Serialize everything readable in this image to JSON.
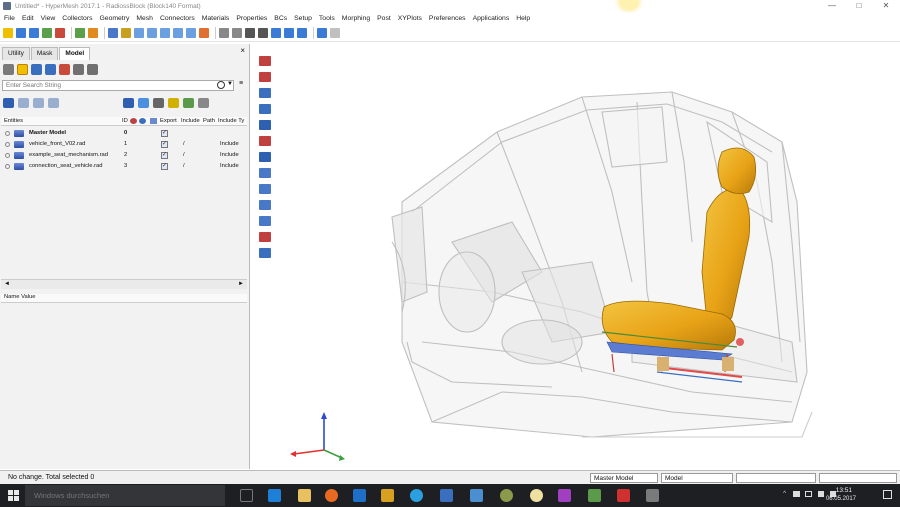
{
  "window": {
    "title": "Untitled* - HyperMesh 2017.1 - RadiossBlock (Block140 Format)",
    "minimize": "—",
    "maximize": "□",
    "close": "✕"
  },
  "menu": [
    "File",
    "Edit",
    "View",
    "Collectors",
    "Geometry",
    "Mesh",
    "Connectors",
    "Materials",
    "Properties",
    "BCs",
    "Setup",
    "Tools",
    "Morphing",
    "Post",
    "XYPlots",
    "Preferences",
    "Applications",
    "Help"
  ],
  "panel": {
    "tabs": [
      "Utility",
      "Mask",
      "Model"
    ],
    "active_tab": "Model",
    "close_label": "×",
    "search_placeholder": "Enter Search String",
    "search_dropdown": "▼",
    "search_menu": "≡",
    "tree_columns": {
      "entities": "Entities",
      "id": "ID",
      "export": "Export",
      "include": "Include",
      "path": "Path",
      "include_type": "Include Ty"
    },
    "tree_rows": [
      {
        "name": "Master Model",
        "id": "0",
        "path": "",
        "include_type": "",
        "bold": true
      },
      {
        "name": "vehicle_front_V02.rad",
        "id": "1",
        "path": "/",
        "include_type": "Include"
      },
      {
        "name": "example_seat_mechanism.rad",
        "id": "2",
        "path": "/",
        "include_type": "Include"
      },
      {
        "name": "connection_seat_vehicle.rad",
        "id": "3",
        "path": "/",
        "include_type": "Include"
      }
    ],
    "checkmark": "✓",
    "scroll_left": "◄",
    "scroll_right": "►",
    "props_columns": "Name Value"
  },
  "status": {
    "message": "No change. Total selected 0",
    "field1": "Master Model",
    "field2": "Model"
  },
  "taskbar": {
    "search_placeholder": "Windows durchsuchen",
    "time": "13:51",
    "date": "06.05.2017"
  },
  "colors": {
    "seat": "#e8a317",
    "toolbar_blue": "#2e6fc9",
    "toolbar_yellow": "#f2c300",
    "toolbar_red": "#cc3333"
  }
}
